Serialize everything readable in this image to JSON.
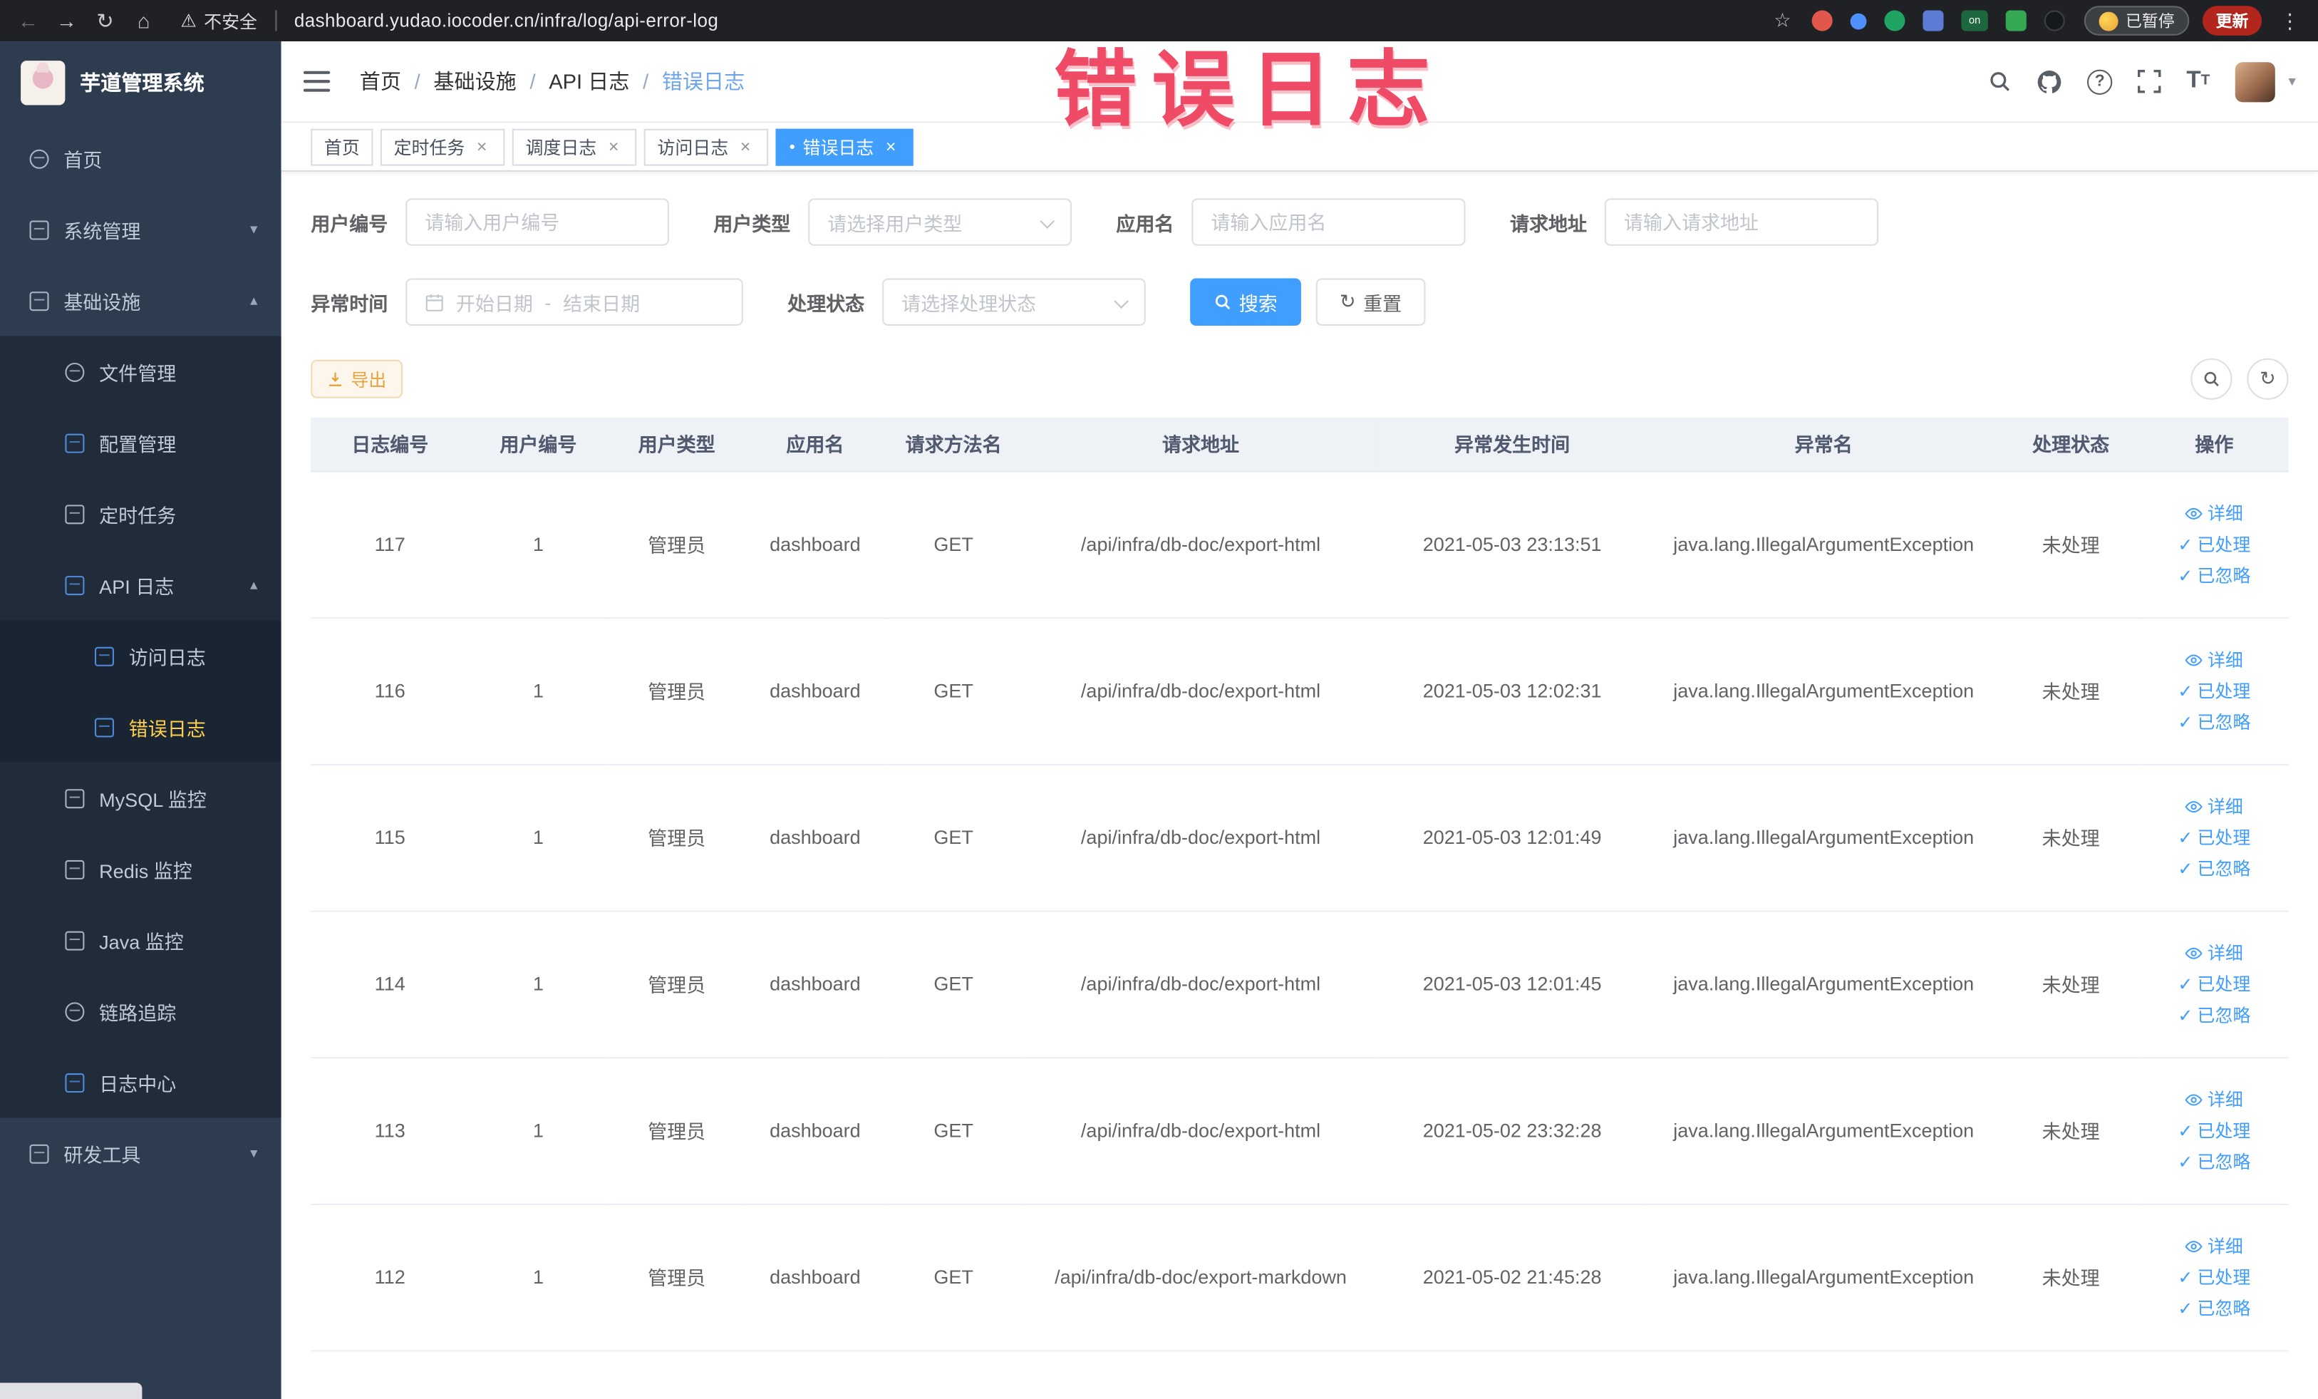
{
  "colors": {
    "accent": "#409eff",
    "warning_button": "#e6a23c",
    "sidebar_active_text": "#ffd04b",
    "annotation_text": "#ef4b66",
    "active_tab_bg": "#409eff"
  },
  "icons": {
    "back": "←",
    "forward": "→",
    "reload": "↻",
    "home": "⌂",
    "warning": "⚠",
    "star": "☆",
    "overflow": "⋮",
    "chevron_down": "▾",
    "chevron_up": "▴",
    "close": "×",
    "active_dot": "●",
    "check": "✓",
    "refresh": "↻",
    "caret_down": "▾",
    "range_dash": "-"
  },
  "annotation": {
    "text": "错误日志"
  },
  "browser": {
    "security_text": "不安全",
    "url": "dashboard.yudao.iocoder.cn/infra/log/api-error-log",
    "extension_badge": "on",
    "paused_label": "已暂停",
    "update_label": "更新"
  },
  "sidebar": {
    "title": "芋道管理系统",
    "menu": [
      {
        "label": "首页"
      },
      {
        "label": "系统管理"
      },
      {
        "label": "基础设施"
      },
      {
        "label": "文件管理"
      },
      {
        "label": "配置管理"
      },
      {
        "label": "定时任务"
      },
      {
        "label": "API 日志"
      },
      {
        "label": "访问日志"
      },
      {
        "label": "错误日志"
      },
      {
        "label": "MySQL 监控"
      },
      {
        "label": "Redis 监控"
      },
      {
        "label": "Java 监控"
      },
      {
        "label": "链路追踪"
      },
      {
        "label": "日志中心"
      },
      {
        "label": "研发工具"
      }
    ]
  },
  "header": {
    "breadcrumbs": [
      "首页",
      "基础设施",
      "API 日志",
      "错误日志"
    ],
    "separator": "/"
  },
  "tabs": [
    {
      "label": "首页"
    },
    {
      "label": "定时任务"
    },
    {
      "label": "调度日志"
    },
    {
      "label": "访问日志"
    },
    {
      "label": "错误日志"
    }
  ],
  "filters": {
    "user_id_label": "用户编号",
    "user_id_placeholder": "请输入用户编号",
    "user_type_label": "用户类型",
    "user_type_placeholder": "请选择用户类型",
    "app_name_label": "应用名",
    "app_name_placeholder": "请输入应用名",
    "request_url_label": "请求地址",
    "request_url_placeholder": "请输入请求地址",
    "exception_time_label": "异常时间",
    "start_placeholder": "开始日期",
    "end_placeholder": "结束日期",
    "status_label": "处理状态",
    "status_placeholder": "请选择处理状态",
    "search_label": "搜索",
    "reset_label": "重置"
  },
  "toolbar": {
    "export_label": "导出"
  },
  "table": {
    "columns": [
      "日志编号",
      "用户编号",
      "用户类型",
      "应用名",
      "请求方法名",
      "请求地址",
      "异常发生时间",
      "异常名",
      "处理状态",
      "操作"
    ],
    "actions": {
      "detail": "详细",
      "processed": "已处理",
      "ignored": "已忽略"
    },
    "rows": [
      {
        "log_id": "117",
        "user_id": "1",
        "user_type": "管理员",
        "app_name": "dashboard",
        "method": "GET",
        "url": "/api/infra/db-doc/export-html",
        "time": "2021-05-03 23:13:51",
        "exception": "java.lang.IllegalArgumentException",
        "status": "未处理"
      },
      {
        "log_id": "116",
        "user_id": "1",
        "user_type": "管理员",
        "app_name": "dashboard",
        "method": "GET",
        "url": "/api/infra/db-doc/export-html",
        "time": "2021-05-03 12:02:31",
        "exception": "java.lang.IllegalArgumentException",
        "status": "未处理"
      },
      {
        "log_id": "115",
        "user_id": "1",
        "user_type": "管理员",
        "app_name": "dashboard",
        "method": "GET",
        "url": "/api/infra/db-doc/export-html",
        "time": "2021-05-03 12:01:49",
        "exception": "java.lang.IllegalArgumentException",
        "status": "未处理"
      },
      {
        "log_id": "114",
        "user_id": "1",
        "user_type": "管理员",
        "app_name": "dashboard",
        "method": "GET",
        "url": "/api/infra/db-doc/export-html",
        "time": "2021-05-03 12:01:45",
        "exception": "java.lang.IllegalArgumentException",
        "status": "未处理"
      },
      {
        "log_id": "113",
        "user_id": "1",
        "user_type": "管理员",
        "app_name": "dashboard",
        "method": "GET",
        "url": "/api/infra/db-doc/export-html",
        "time": "2021-05-02 23:32:28",
        "exception": "java.lang.IllegalArgumentException",
        "status": "未处理"
      },
      {
        "log_id": "112",
        "user_id": "1",
        "user_type": "管理员",
        "app_name": "dashboard",
        "method": "GET",
        "url": "/api/infra/db-doc/export-markdown",
        "time": "2021-05-02 21:45:28",
        "exception": "java.lang.IllegalArgumentException",
        "status": "未处理"
      }
    ]
  }
}
